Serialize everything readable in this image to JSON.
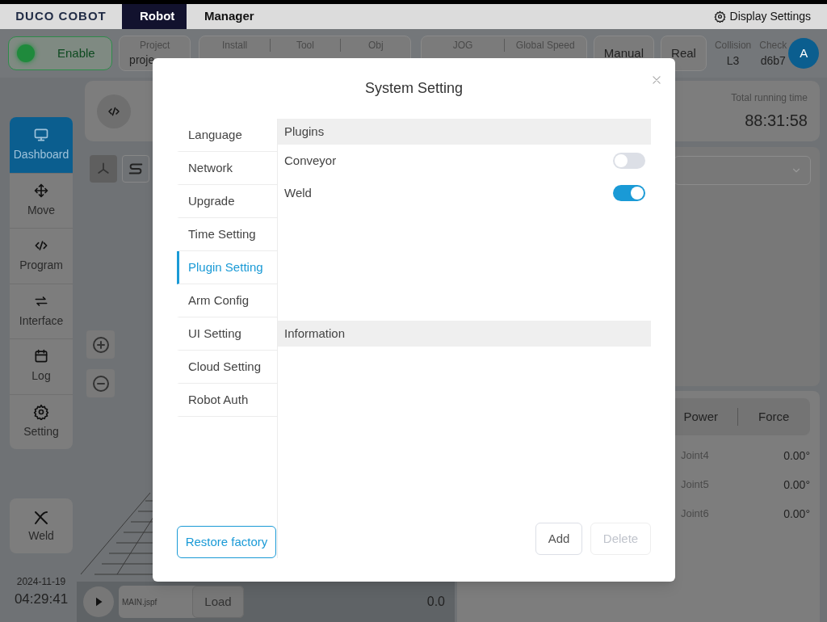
{
  "top_bar": {
    "logo": "DUCO COBOT",
    "tabs": [
      {
        "label": "Robot",
        "selected": true
      },
      {
        "label": "Manager",
        "selected": false
      }
    ],
    "display_settings": "Display Settings"
  },
  "toolbar": {
    "enable": "Enable",
    "project": {
      "label": "Project",
      "value": "proje"
    },
    "install_group": [
      "Install",
      "Tool",
      "Obj"
    ],
    "speed_group": [
      "JOG",
      "Global Speed"
    ],
    "mode_buttons": [
      "Manual",
      "Real"
    ],
    "collision": {
      "label": "Collision",
      "value": "L3"
    },
    "check": {
      "label": "Check",
      "value": "d6b7"
    },
    "avatar": "A"
  },
  "nav": [
    {
      "label": "Dashboard",
      "selected": true
    },
    {
      "label": "Move",
      "selected": false
    },
    {
      "label": "Program",
      "selected": false
    },
    {
      "label": "Interface",
      "selected": false
    },
    {
      "label": "Log",
      "selected": false
    },
    {
      "label": "Setting",
      "selected": false
    }
  ],
  "weld_button": "Weld",
  "clock": {
    "date": "2024-11-19",
    "time": "04:29:41"
  },
  "status_card": {
    "running_time_label": "Total running time",
    "running_time": "88:31:58"
  },
  "panel_tabs": [
    "Power",
    "Force"
  ],
  "joints": [
    {
      "name": "Joint4",
      "value": "0.00°"
    },
    {
      "name": "Joint5",
      "value": "0.00°"
    },
    {
      "name": "Joint6",
      "value": "0.00°"
    }
  ],
  "program_bar": {
    "file": "MAIN.jspf",
    "load": "Load",
    "value": "0.0"
  },
  "dialog": {
    "title": "System Setting",
    "menu": [
      {
        "label": "Language",
        "selected": false
      },
      {
        "label": "Network",
        "selected": false
      },
      {
        "label": "Upgrade",
        "selected": false
      },
      {
        "label": "Time Setting",
        "selected": false
      },
      {
        "label": "Plugin Setting",
        "selected": true
      },
      {
        "label": "Arm Config",
        "selected": false
      },
      {
        "label": "UI Setting",
        "selected": false
      },
      {
        "label": "Cloud Setting",
        "selected": false
      },
      {
        "label": "Robot Auth",
        "selected": false
      }
    ],
    "restore": "Restore factory",
    "plugins_header": "Plugins",
    "plugins": [
      {
        "name": "Conveyor",
        "on": false
      },
      {
        "name": "Weld",
        "on": true
      }
    ],
    "information_header": "Information",
    "buttons": [
      {
        "label": "Add",
        "disabled": false
      },
      {
        "label": "Delete",
        "disabled": true
      }
    ]
  }
}
